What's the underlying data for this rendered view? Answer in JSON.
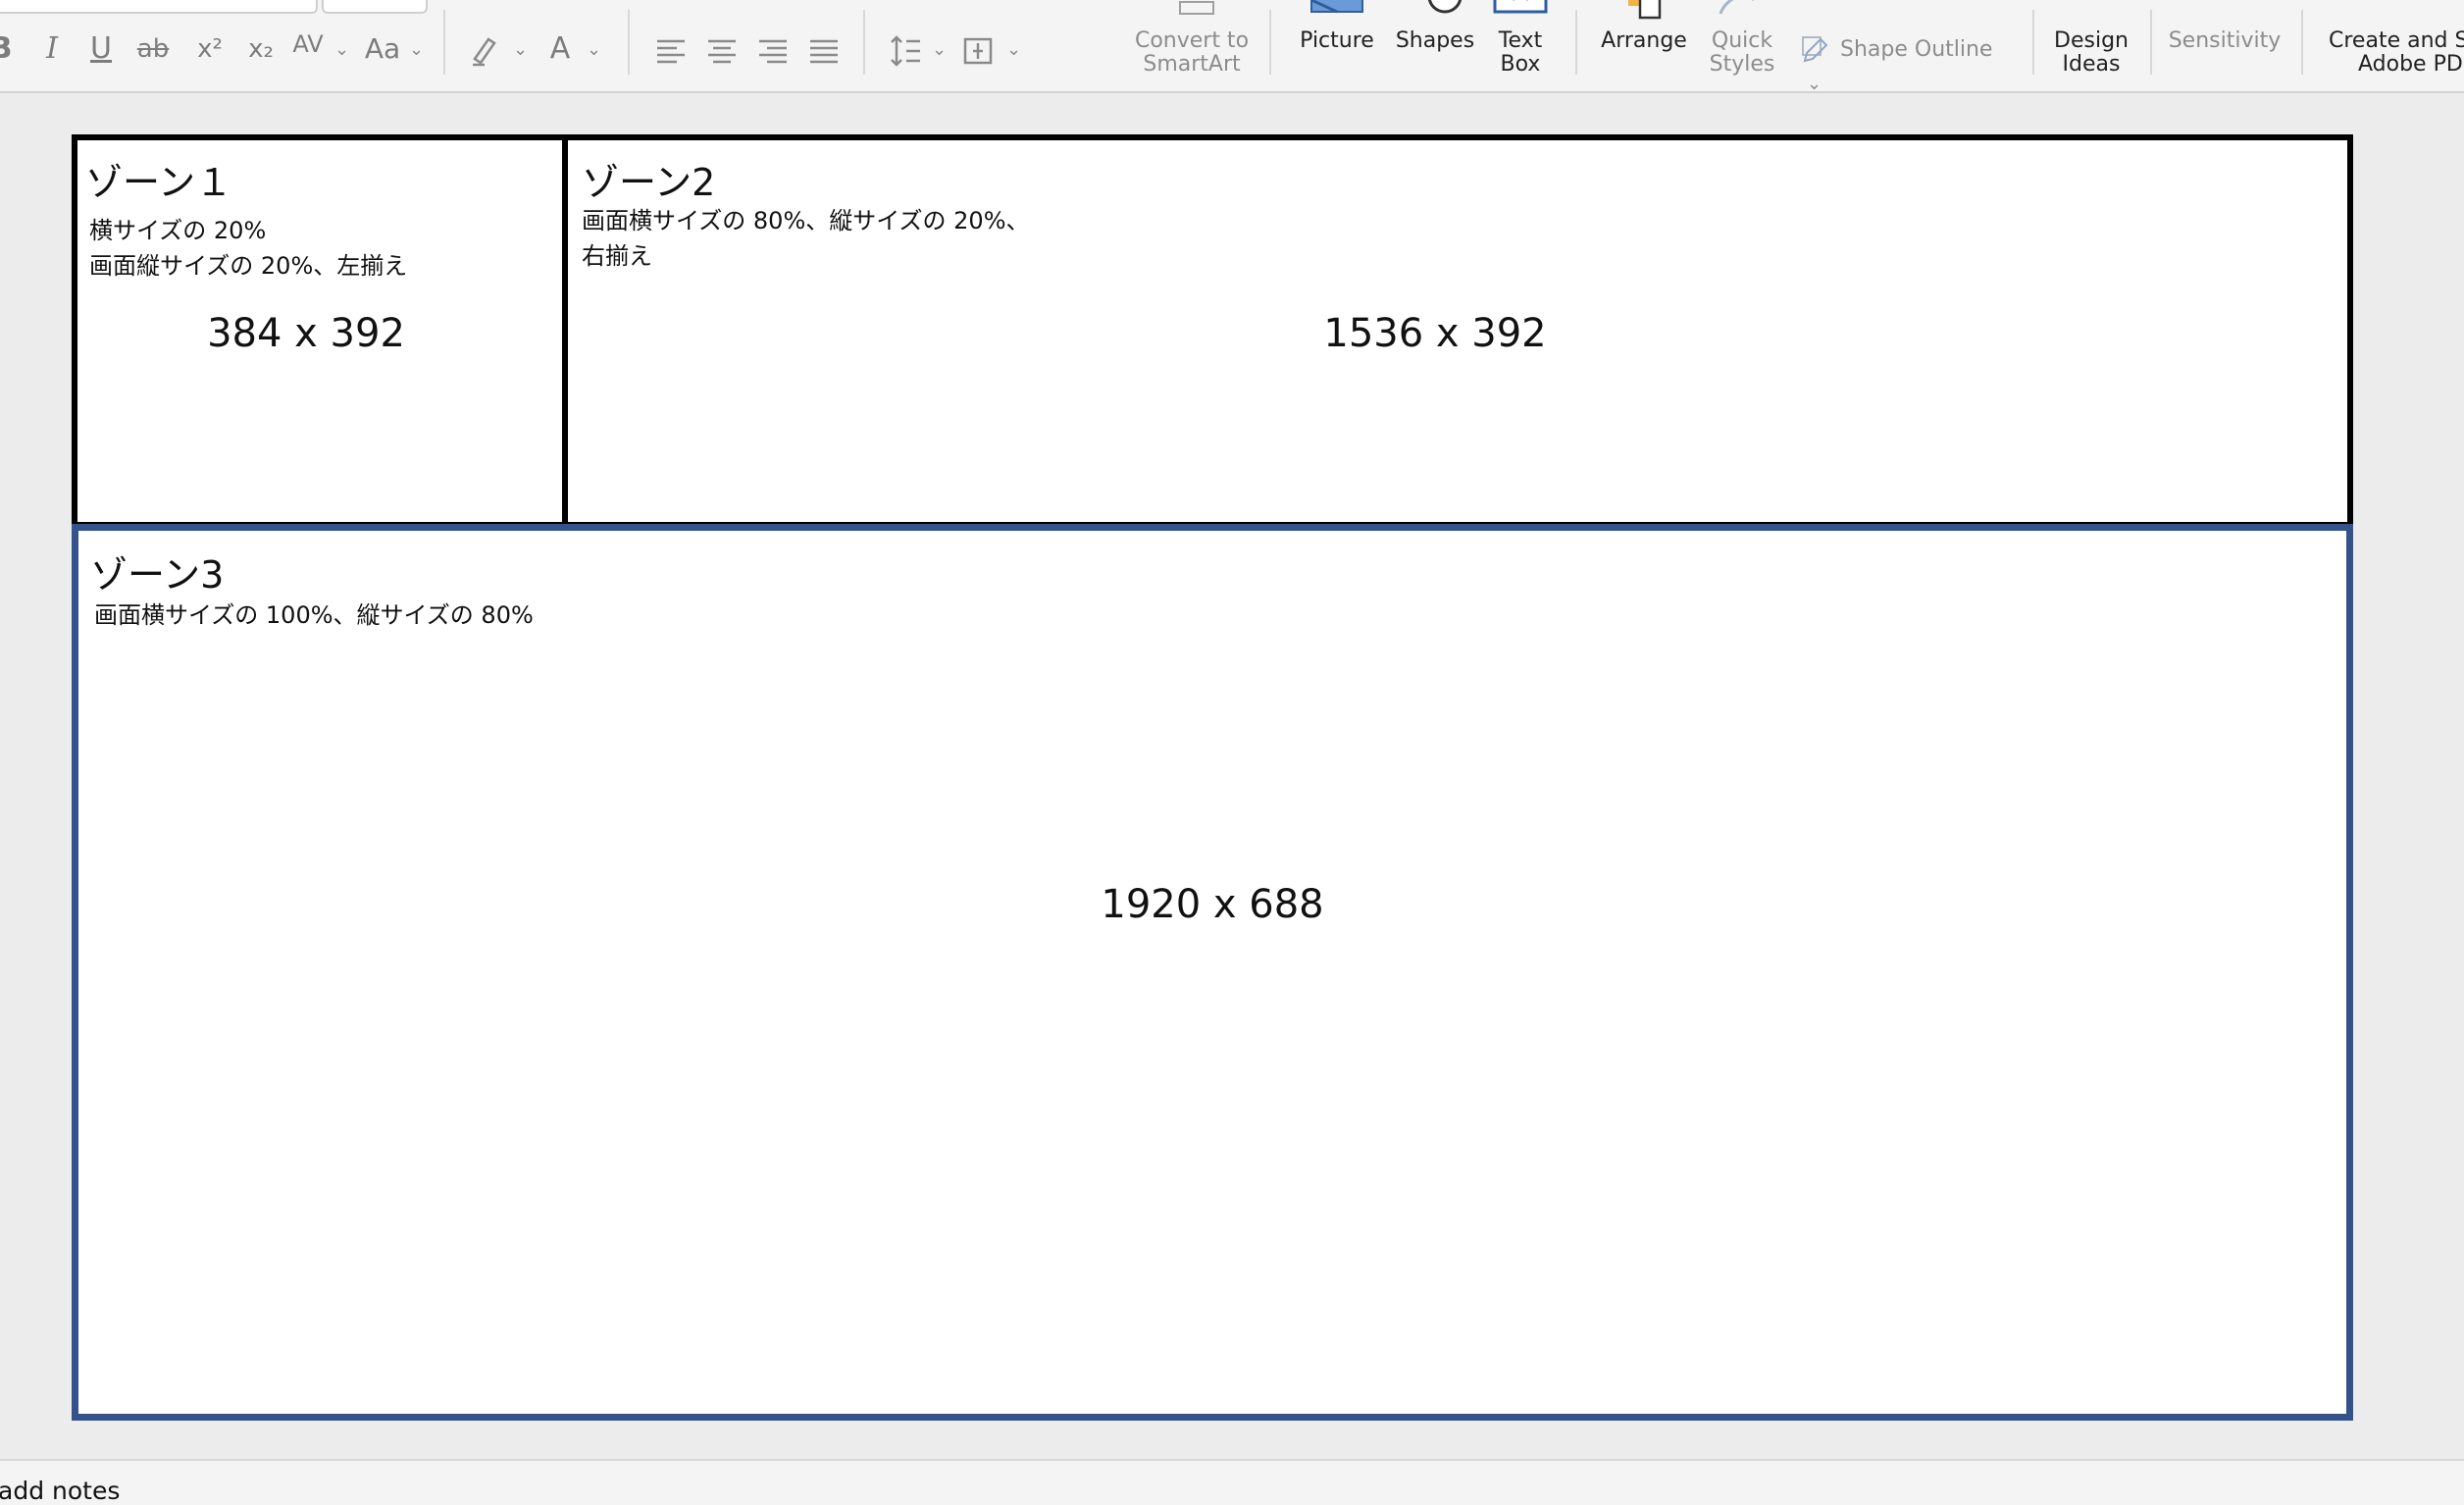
{
  "ribbon": {
    "format_buttons": {
      "bold": "B",
      "italic": "I",
      "underline": "U",
      "strikethrough": "ab",
      "superscript": "x²",
      "subscript": "x₂",
      "char_spacing": "AV",
      "change_case": "Aa",
      "font_color": "A"
    },
    "convert_smartart": {
      "line1": "Convert to",
      "line2": "SmartArt"
    },
    "picture": "Picture",
    "shapes": "Shapes",
    "textbox": {
      "line1": "Text",
      "line2": "Box"
    },
    "arrange": "Arrange",
    "quick_styles": {
      "line1": "Quick",
      "line2": "Styles"
    },
    "shape_outline": "Shape Outline",
    "design_ideas": {
      "line1": "Design",
      "line2": "Ideas"
    },
    "sensitivity": "Sensitivity",
    "adobe": {
      "line1": "Create and Sh",
      "line2": "Adobe PDF"
    }
  },
  "slide": {
    "zone1": {
      "title": "ゾーン１",
      "desc1": "横サイズの 20%",
      "desc2": "画面縦サイズの 20%、左揃え",
      "size": "384 x 392"
    },
    "zone2": {
      "title": "ゾーン2",
      "desc1": "画面横サイズの 80%、縦サイズの 20%、",
      "desc2": "右揃え",
      "size": "1536 x 392"
    },
    "zone3": {
      "title": "ゾーン3",
      "desc1": "画面横サイズの 100%、縦サイズの 80%",
      "size": "1920 x 688"
    }
  },
  "notes": {
    "placeholder": "add notes"
  },
  "colors": {
    "zone3_border": "#34538c",
    "zone_border": "#000000"
  }
}
